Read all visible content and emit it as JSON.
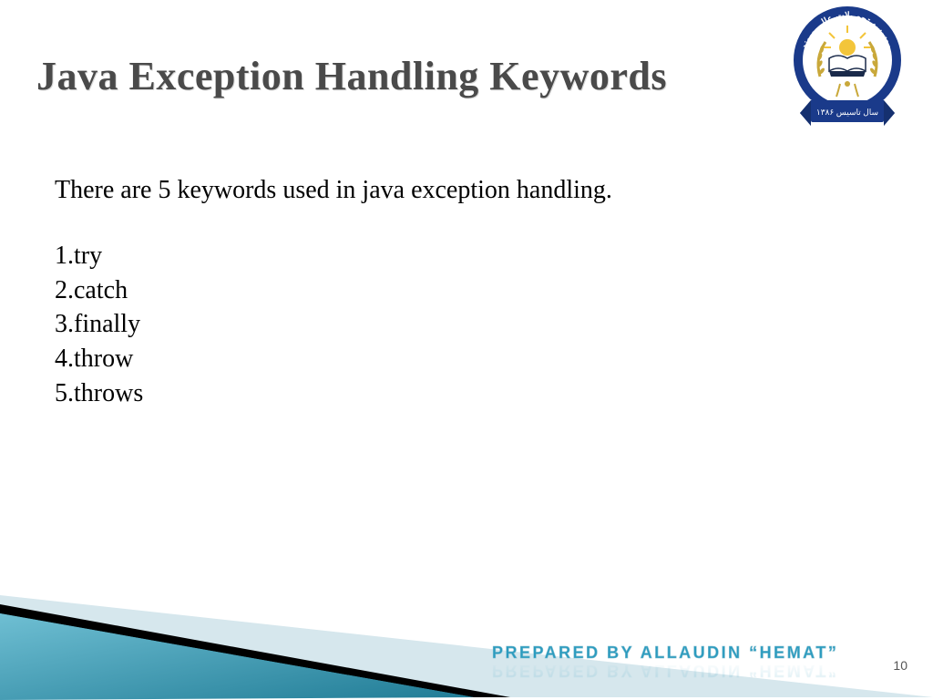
{
  "title": "Java Exception Handling Keywords",
  "intro": "There are 5 keywords used in java exception handling.",
  "keywords": [
    "try",
    "catch",
    "finally",
    "throw",
    "throws"
  ],
  "footer": {
    "prepared_by": "PREPARED  BY  ALLAUDIN  “HEMAT”",
    "page_number": "10"
  },
  "logo": {
    "top_text_ar": "موسسه تحصیلات عالی میوند",
    "bottom_text_ar": "سال تاسیس ۱۳۸۶"
  }
}
